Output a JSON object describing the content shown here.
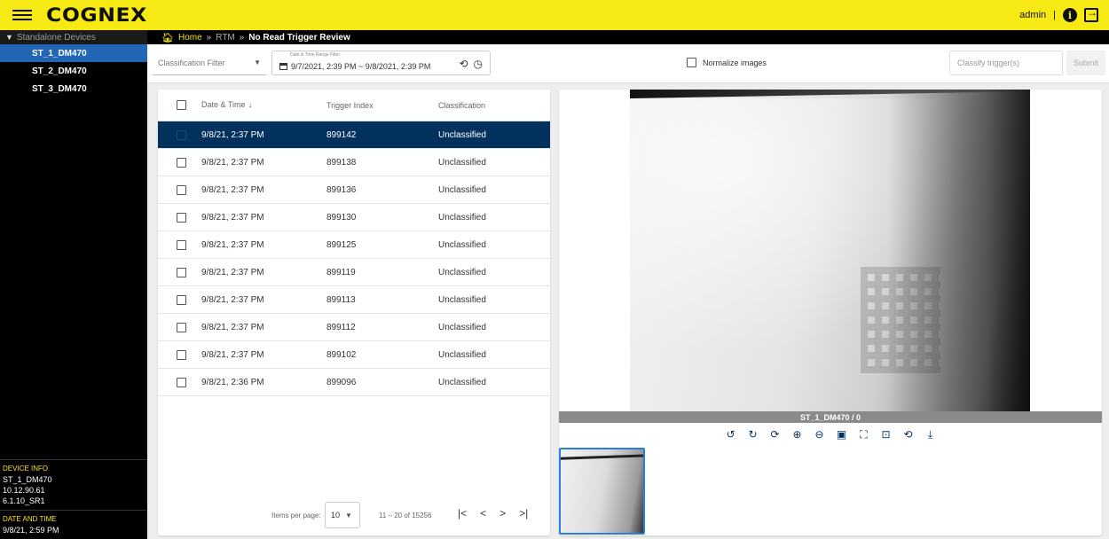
{
  "app": {
    "logo": "COGNEX",
    "user": "admin",
    "user_sep": "|"
  },
  "sidebar": {
    "section_title": "Standalone Devices",
    "devices": [
      {
        "label": "ST_1_DM470"
      },
      {
        "label": "ST_2_DM470"
      },
      {
        "label": "ST_3_DM470"
      }
    ],
    "device_info_label": "DEVICE INFO",
    "device_name": "ST_1_DM470",
    "device_ip": "10.12.90.61",
    "device_firmware": "6.1.10_SR1",
    "date_time_label": "DATE AND TIME",
    "date_time_value": "9/8/21, 2:59 PM"
  },
  "breadcrumb": {
    "home": "Home",
    "sep": "»",
    "rtm": "RTM",
    "current": "No Read Trigger Review"
  },
  "filters": {
    "classification_placeholder": "Classification Filter",
    "date_range_label": "Date & Time Range Filter",
    "date_range_value": "9/7/2021, 2:39 PM ~ 9/8/2021, 2:39 PM",
    "normalize_label": "Normalize images",
    "classify_placeholder": "Classify trigger(s)",
    "submit_label": "Submit"
  },
  "table": {
    "headers": {
      "datetime": "Date & Time",
      "trigger_index": "Trigger Index",
      "classification": "Classification"
    },
    "rows": [
      {
        "datetime": "9/8/21, 2:37 PM",
        "trigger_index": "899142",
        "classification": "Unclassified"
      },
      {
        "datetime": "9/8/21, 2:37 PM",
        "trigger_index": "899138",
        "classification": "Unclassified"
      },
      {
        "datetime": "9/8/21, 2:37 PM",
        "trigger_index": "899136",
        "classification": "Unclassified"
      },
      {
        "datetime": "9/8/21, 2:37 PM",
        "trigger_index": "899130",
        "classification": "Unclassified"
      },
      {
        "datetime": "9/8/21, 2:37 PM",
        "trigger_index": "899125",
        "classification": "Unclassified"
      },
      {
        "datetime": "9/8/21, 2:37 PM",
        "trigger_index": "899119",
        "classification": "Unclassified"
      },
      {
        "datetime": "9/8/21, 2:37 PM",
        "trigger_index": "899113",
        "classification": "Unclassified"
      },
      {
        "datetime": "9/8/21, 2:37 PM",
        "trigger_index": "899112",
        "classification": "Unclassified"
      },
      {
        "datetime": "9/8/21, 2:37 PM",
        "trigger_index": "899102",
        "classification": "Unclassified"
      },
      {
        "datetime": "9/8/21, 2:36 PM",
        "trigger_index": "899096",
        "classification": "Unclassified"
      }
    ],
    "selected_row": 0
  },
  "paginator": {
    "items_per_page_label": "Items per page:",
    "items_per_page_value": "10",
    "range_label": "11 – 20 of 15256"
  },
  "image_viewer": {
    "caption": "ST_1_DM470 / 0"
  },
  "colors": {
    "brand_yellow": "#f7ea14",
    "selected_row": "#03315d",
    "sidebar_active": "#2266b5"
  }
}
